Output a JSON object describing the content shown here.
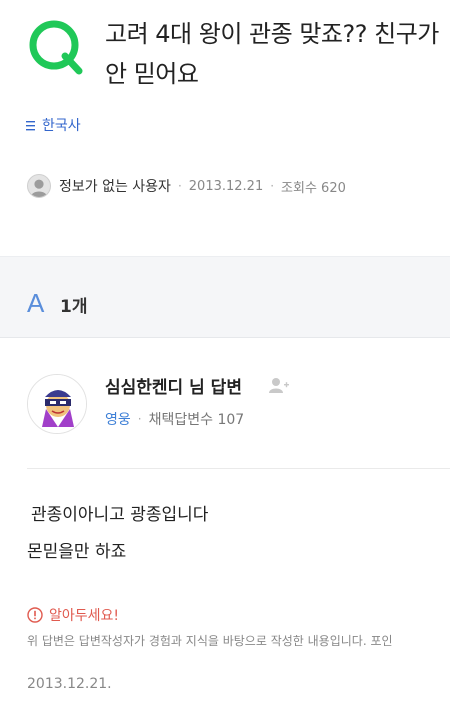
{
  "question": {
    "title": "고려 4대 왕이 관종 맞죠?? 친구가 안 믿어요",
    "category": "한국사",
    "author": "정보가 없는 사용자",
    "date": "2013.12.21",
    "views": "조회수 620"
  },
  "answers": {
    "badge": "A",
    "count": "1개"
  },
  "answer": {
    "answerer": "심심한켄디",
    "suffix": " 님 답변",
    "rank": "영웅",
    "adopted": "채택답변수 107",
    "line1": "관종이아니고 광종입니다",
    "line2": "몬믿을만 하죠",
    "notice_title": "알아두세요!",
    "notice_body": "위 답변은 답변작성자가 경험과 지식을 바탕으로 작성한 내용입니다. 포인",
    "date": "2013.12.21."
  },
  "colors": {
    "brand_green": "#20c858",
    "link_blue": "#3366cc",
    "notice_red": "#e05a4f"
  }
}
